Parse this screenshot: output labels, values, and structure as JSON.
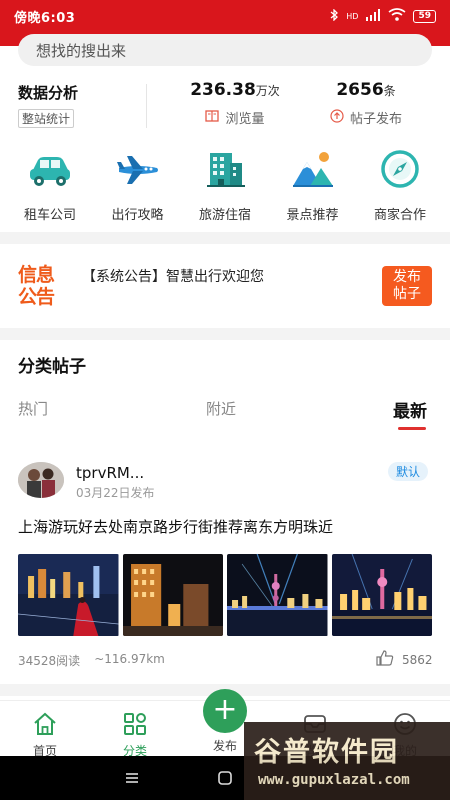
{
  "status_bar": {
    "time": "傍晚6:03",
    "network": "HD",
    "battery": "59"
  },
  "search": {
    "placeholder": "想找的搜出来"
  },
  "stats": {
    "title": "数据分析",
    "subtitle": "整站统计",
    "views_value": "236.38",
    "views_unit": "万次",
    "views_label": "浏览量",
    "posts_value": "2656",
    "posts_unit": "条",
    "posts_label": "帖子发布"
  },
  "categories": [
    {
      "label": "租车公司",
      "icon": "car-icon"
    },
    {
      "label": "出行攻略",
      "icon": "airplane-icon"
    },
    {
      "label": "旅游住宿",
      "icon": "hotel-icon"
    },
    {
      "label": "景点推荐",
      "icon": "mountain-icon"
    },
    {
      "label": "商家合作",
      "icon": "compass-icon"
    }
  ],
  "notice": {
    "badge_line1": "信息",
    "badge_line2": "公告",
    "text": "【系统公告】智慧出行欢迎您",
    "button_line1": "发布",
    "button_line2": "帖子"
  },
  "section": {
    "title": "分类帖子",
    "tabs": [
      {
        "label": "热门"
      },
      {
        "label": "附近"
      },
      {
        "label": "最新"
      }
    ],
    "active_tab": "最新"
  },
  "post": {
    "author": "tprvRM...",
    "date": "03月22日发布",
    "tag": "默认",
    "title": "上海游玩好去处南京路步行街推荐离东方明珠近",
    "reads": "34528阅读",
    "distance": "~116.97km",
    "likes": "5862"
  },
  "bottom_nav": {
    "home": "首页",
    "category": "分类",
    "publish": "发布",
    "publish_symbol": "+",
    "messages": "消息",
    "mine": "我的"
  },
  "watermark": {
    "title": "谷普软件园",
    "url": "www.gupuxlazal.com"
  },
  "colors": {
    "brand_red": "#d9161c",
    "accent_green": "#2e9f5a",
    "notice_orange": "#f55a1f",
    "tab_underline": "#e0312f"
  }
}
